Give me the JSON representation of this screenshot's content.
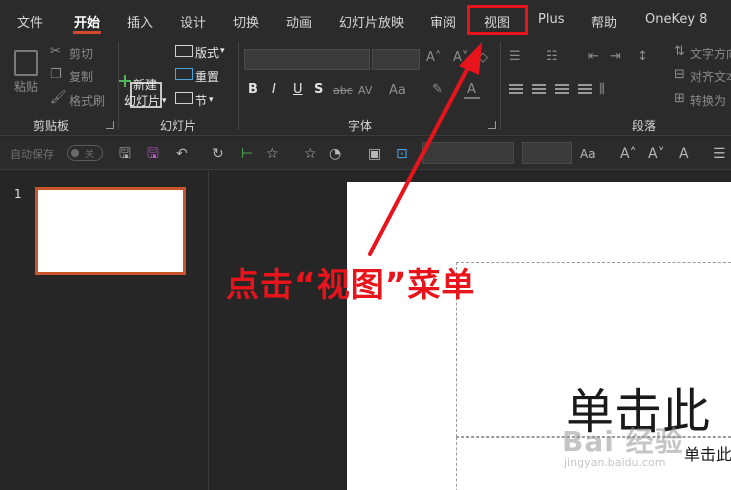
{
  "tabs": [
    "文件",
    "开始",
    "插入",
    "设计",
    "切换",
    "动画",
    "幻灯片放映",
    "审阅",
    "视图",
    "Plus",
    "帮助",
    "OneKey 8"
  ],
  "active_tab": "开始",
  "clipboard": {
    "paste": "粘贴",
    "cut": "剪切",
    "copy": "复制",
    "format_painter": "格式刷",
    "label": "剪贴板"
  },
  "slides_group": {
    "new_slide_line1": "新建",
    "new_slide_line2": "幻灯片",
    "layout": "版式",
    "reset": "重置",
    "section": "节",
    "label": "幻灯片"
  },
  "font_group": {
    "label": "字体",
    "bold": "B",
    "italic": "I",
    "underline": "U",
    "shadow": "S",
    "strike": "abc",
    "spacing": "AV",
    "case": "Aa"
  },
  "paragraph_group": {
    "label": "段落",
    "text_direction": "文字方向",
    "align_text": "对齐文本",
    "convert": "转换为"
  },
  "qat": {
    "autosave": "自动保存",
    "toggle": "关",
    "case": "Aa"
  },
  "slide_number": "1",
  "slide": {
    "title_placeholder": "单击此",
    "subtitle_placeholder": "单击此"
  },
  "annotation": "点击“视图”菜单",
  "watermark": {
    "brand": "Bai 经验",
    "url": "jingyan.baidu.com"
  },
  "colors": {
    "accent": "#d04a2b",
    "annotation": "#e8141b",
    "ribbon_bg": "#2b2b2b"
  }
}
